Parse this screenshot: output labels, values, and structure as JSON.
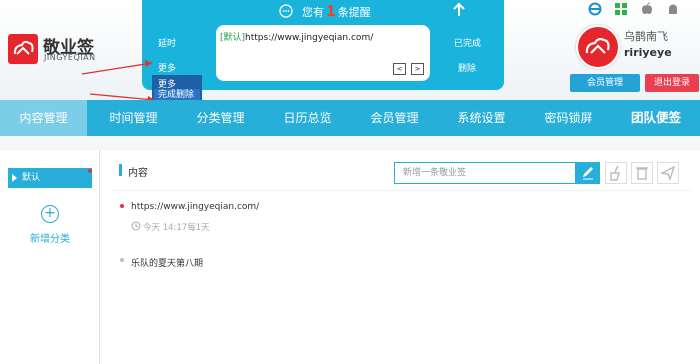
{
  "brand": {
    "title": "敬业签",
    "subtitle": "JINGYEQIAN"
  },
  "popup": {
    "prefix": "您有",
    "count": "1",
    "suffix": "条提醒",
    "note_tag": "[默认]",
    "note_text": "https://www.jingyeqian.com/",
    "prev_label": "<",
    "next_label": ">",
    "left_delay": "延时",
    "left_more": "更多",
    "right_done": "已完成",
    "right_delete": "删除"
  },
  "more_menu": {
    "more": "更多",
    "done_delete": "完成删除"
  },
  "user": {
    "name": "乌鹊南飞",
    "id": "ririyeye",
    "member_btn": "会员管理",
    "logout_btn": "退出登录"
  },
  "nav": [
    {
      "label": "内容管理"
    },
    {
      "label": "时间管理"
    },
    {
      "label": "分类管理"
    },
    {
      "label": "日历总览"
    },
    {
      "label": "会员管理"
    },
    {
      "label": "系统设置"
    },
    {
      "label": "密码锁屏"
    },
    {
      "label": "团队便签"
    }
  ],
  "sidebar": {
    "default_label": "默认",
    "add_label": "新增分类"
  },
  "main": {
    "section_title": "内容",
    "new_placeholder": "新增一条敬业签",
    "items": [
      {
        "text": "https://www.jingyeqian.com/",
        "time": "今天 14:17每1天"
      },
      {
        "text": "乐队的夏天第八期"
      }
    ]
  },
  "colors": {
    "accent": "#27aed9",
    "active_tab": "#7ccde8",
    "logout": "#e8404f",
    "brand_red": "#e5272d"
  }
}
